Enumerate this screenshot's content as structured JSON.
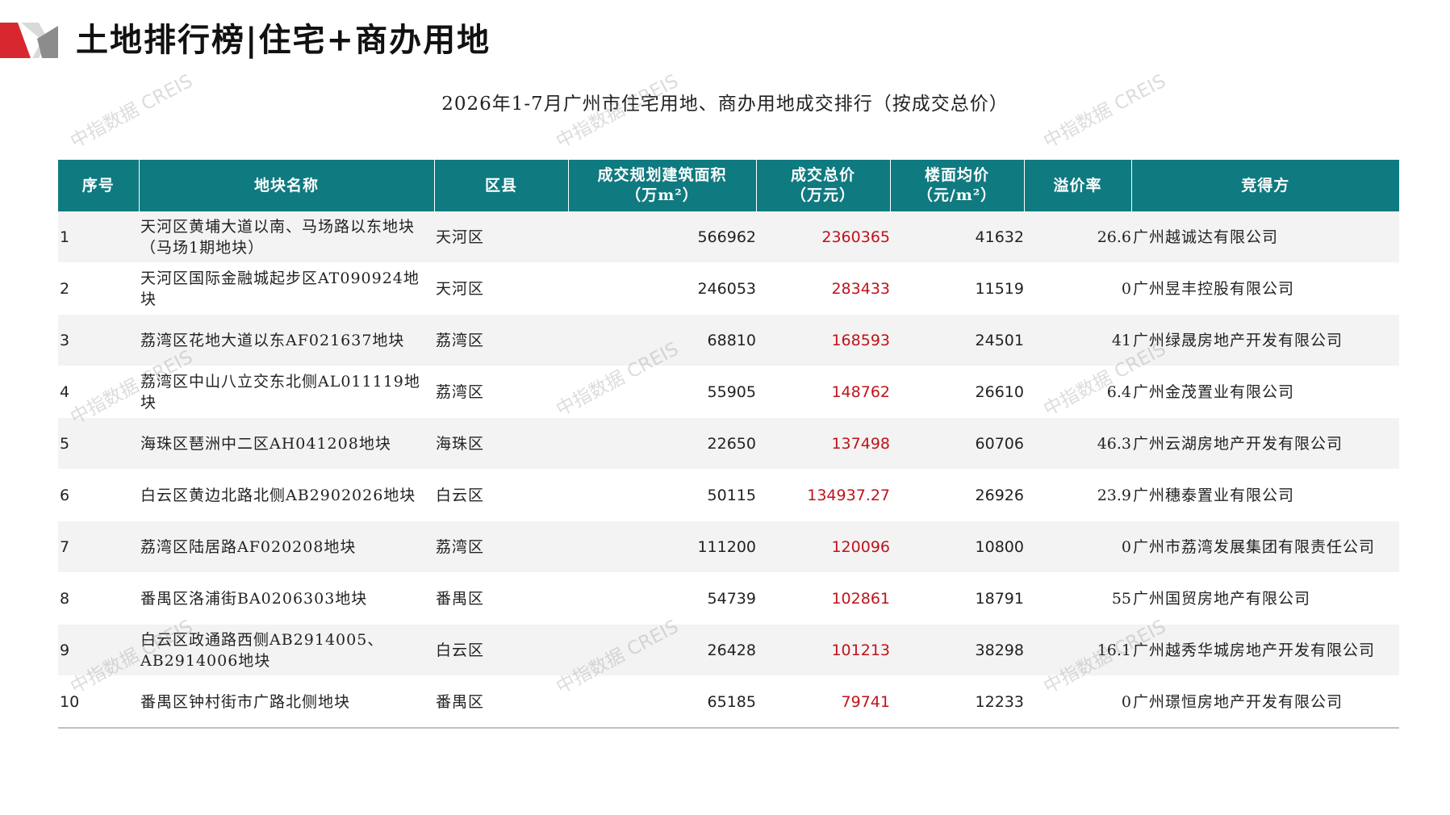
{
  "header": {
    "title": "土地排行榜|住宅+商办用地"
  },
  "table": {
    "caption": "2026年1-7月广州市住宅用地、商办用地成交排行（按成交总价）",
    "columns": [
      {
        "line1": "序号",
        "line2": ""
      },
      {
        "line1": "地块名称",
        "line2": ""
      },
      {
        "line1": "区县",
        "line2": ""
      },
      {
        "line1": "成交规划建筑面积",
        "line2": "（万m²）"
      },
      {
        "line1": "成交总价",
        "line2": "（万元）"
      },
      {
        "line1": "楼面均价",
        "line2": "（元/m²）"
      },
      {
        "line1": "溢价率",
        "line2": ""
      },
      {
        "line1": "竞得方",
        "line2": ""
      }
    ],
    "rows": [
      {
        "rank": "1",
        "name": "天河区黄埔大道以南、马场路以东地块（马场1期地块）",
        "district": "天河区",
        "area": "566962",
        "total": "2360365",
        "unit_price": "41632",
        "premium": "26.6",
        "winner": "广州越诚达有限公司"
      },
      {
        "rank": "2",
        "name": "天河区国际金融城起步区AT090924地块",
        "district": "天河区",
        "area": "246053",
        "total": "283433",
        "unit_price": "11519",
        "premium": "0",
        "winner": "广州昱丰控股有限公司"
      },
      {
        "rank": "3",
        "name": "荔湾区花地大道以东AF021637地块",
        "district": "荔湾区",
        "area": "68810",
        "total": "168593",
        "unit_price": "24501",
        "premium": "41",
        "winner": "广州绿晟房地产开发有限公司"
      },
      {
        "rank": "4",
        "name": "荔湾区中山八立交东北侧AL011119地块",
        "district": "荔湾区",
        "area": "55905",
        "total": "148762",
        "unit_price": "26610",
        "premium": "6.4",
        "winner": "广州金茂置业有限公司"
      },
      {
        "rank": "5",
        "name": "海珠区琶洲中二区AH041208地块",
        "district": "海珠区",
        "area": "22650",
        "total": "137498",
        "unit_price": "60706",
        "premium": "46.3",
        "winner": "广州云湖房地产开发有限公司"
      },
      {
        "rank": "6",
        "name": "白云区黄边北路北侧AB2902026地块",
        "district": "白云区",
        "area": "50115",
        "total": "134937.27",
        "unit_price": "26926",
        "premium": "23.9",
        "winner": "广州穗泰置业有限公司"
      },
      {
        "rank": "7",
        "name": "荔湾区陆居路AF020208地块",
        "district": "荔湾区",
        "area": "111200",
        "total": "120096",
        "unit_price": "10800",
        "premium": "0",
        "winner": "广州市荔湾发展集团有限责任公司"
      },
      {
        "rank": "8",
        "name": "番禺区洛浦街BA0206303地块",
        "district": "番禺区",
        "area": "54739",
        "total": "102861",
        "unit_price": "18791",
        "premium": "55",
        "winner": "广州国贸房地产有限公司"
      },
      {
        "rank": "9",
        "name": "白云区政通路西侧AB2914005、AB2914006地块",
        "district": "白云区",
        "area": "26428",
        "total": "101213",
        "unit_price": "38298",
        "premium": "16.1",
        "winner": "广州越秀华城房地产开发有限公司"
      },
      {
        "rank": "10",
        "name": "番禺区钟村街市广路北侧地块",
        "district": "番禺区",
        "area": "65185",
        "total": "79741",
        "unit_price": "12233",
        "premium": "0",
        "winner": "广州璟恒房地产开发有限公司"
      }
    ]
  },
  "watermark": {
    "text": "中指数据 CREIS"
  },
  "colors": {
    "header_bg": "#0f7a80",
    "total_price_red": "#c0131b",
    "logo_red": "#d7282f",
    "logo_gray": "#8c8c8c"
  }
}
